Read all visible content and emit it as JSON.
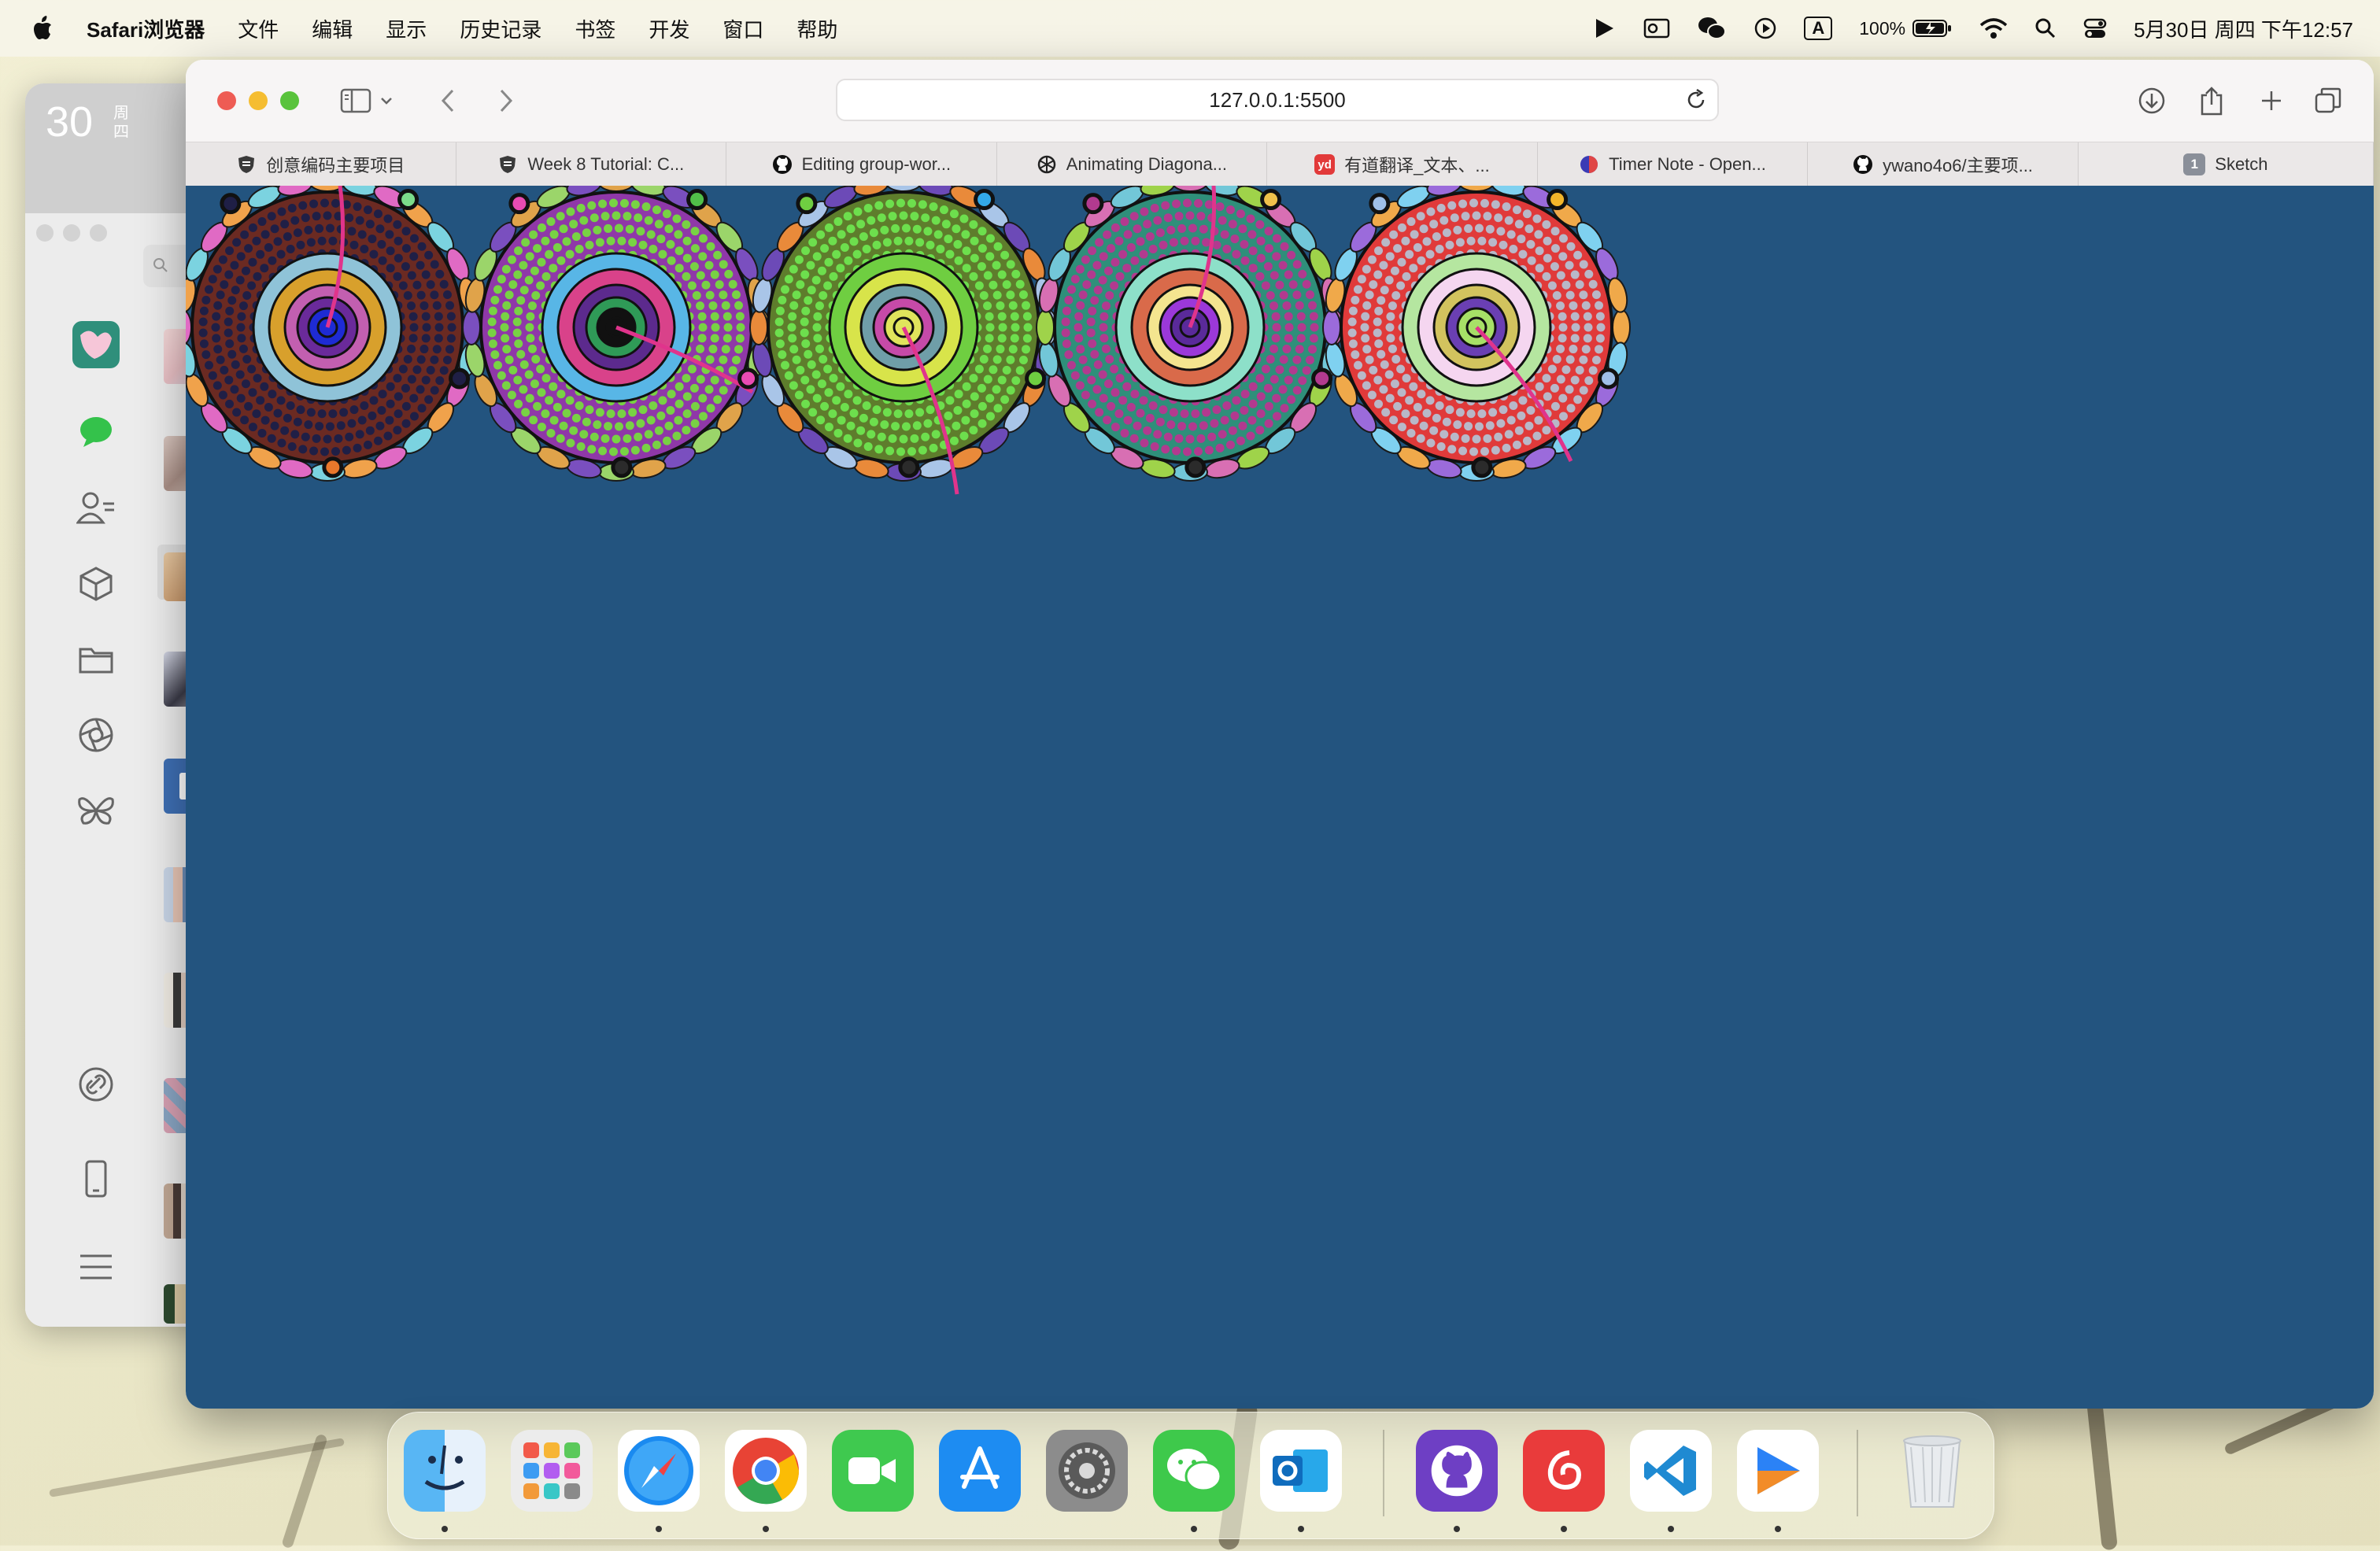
{
  "menubar": {
    "apple": "",
    "app_name": "Safari浏览器",
    "menus": [
      "文件",
      "编辑",
      "显示",
      "历史记录",
      "书签",
      "开发",
      "窗口",
      "帮助"
    ],
    "battery": "100%",
    "input_method": "A",
    "clock": "5月30日 周四 下午12:57"
  },
  "widget": {
    "day": "30",
    "weekday_top": "周",
    "weekday_bottom": "四"
  },
  "browser": {
    "url": "127.0.0.1:5500",
    "tabs": [
      {
        "label": "创意编码主要项目",
        "favicon": "shield-icon",
        "color": "#555555"
      },
      {
        "label": "Week 8 Tutorial: C...",
        "favicon": "shield-icon",
        "color": "#555555"
      },
      {
        "label": "Editing group-wor...",
        "favicon": "github-icon",
        "color": "#111111"
      },
      {
        "label": "Animating Diagona...",
        "favicon": "openai-icon",
        "color": "#111111"
      },
      {
        "label": "有道翻译_文本、...",
        "favicon": "youdao-icon",
        "color": "#e23a3a"
      },
      {
        "label": "Timer Note - Open...",
        "favicon": "timer-icon",
        "color": "#3b3bb5"
      },
      {
        "label": "ywano4o6/主要项...",
        "favicon": "github-icon",
        "color": "#111111"
      }
    ],
    "tab_group": {
      "badge": "1",
      "label": "Sketch"
    },
    "canvas_bg": "#23547f"
  },
  "dock": {
    "apps": [
      "finder",
      "launchpad",
      "safari",
      "chrome",
      "facetime",
      "app-store",
      "system-settings",
      "wechat",
      "outlook",
      "github-desktop",
      "netease-music",
      "vscode",
      "infuse",
      "trash"
    ]
  }
}
